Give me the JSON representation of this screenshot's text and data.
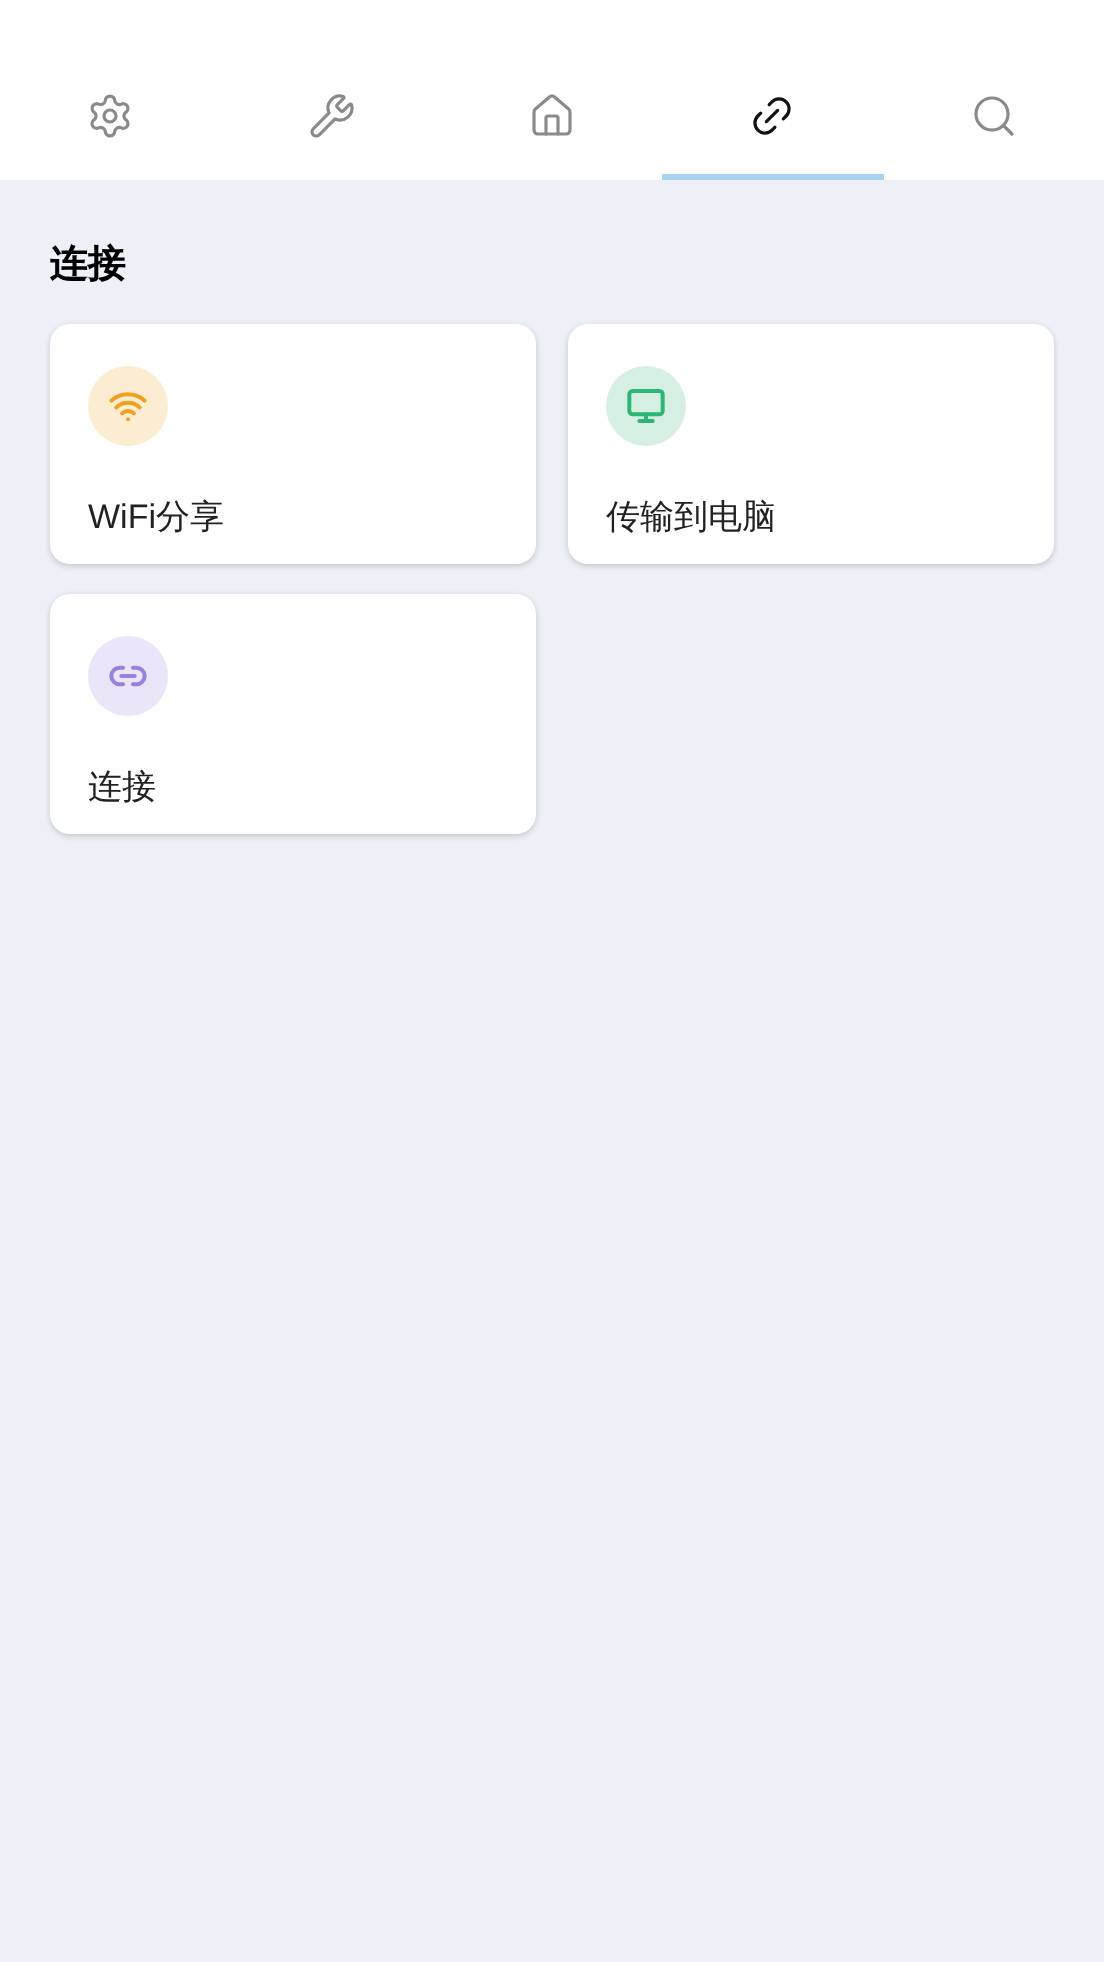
{
  "tabs": [
    {
      "kind": "settings",
      "selected": false
    },
    {
      "kind": "tools",
      "selected": false
    },
    {
      "kind": "home",
      "selected": false
    },
    {
      "kind": "link",
      "selected": true
    },
    {
      "kind": "search",
      "selected": false
    }
  ],
  "section": {
    "title": "连接",
    "cards": [
      {
        "label": "WiFi分享",
        "kind": "wifi",
        "color": "#f0a01c"
      },
      {
        "label": "传输到电脑",
        "kind": "monitor",
        "color": "#2bb673"
      },
      {
        "label": "连接",
        "kind": "link",
        "color": "#9b7fe0"
      }
    ]
  }
}
